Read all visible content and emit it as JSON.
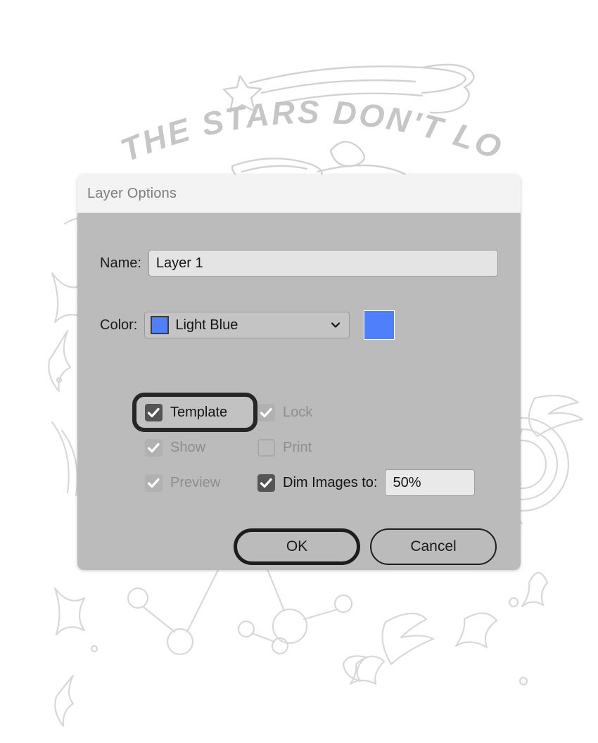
{
  "background": {
    "headline": "THE STARS DON'T LOOK",
    "description": "light-gray hand-drawn sketch of stars, sparkles, constellations and a comet",
    "ink_color": "#cfcfcf",
    "page_color": "#ffffff"
  },
  "dialog": {
    "title": "Layer Options",
    "titlebar_color": "#f3f3f3",
    "body_color": "#bbbbbb",
    "name": {
      "label": "Name:",
      "value": "Layer 1",
      "placeholder": "Layer name"
    },
    "color": {
      "label": "Color:",
      "selected": "Light Blue",
      "swatch_hex": "#4f7ffb",
      "preview_hex": "#4f7ffb",
      "chevron_icon": "chevron-down-icon",
      "options": [
        "Light Blue"
      ]
    },
    "options": {
      "template": {
        "label": "Template",
        "checked": true,
        "disabled": false,
        "focused": true
      },
      "lock": {
        "label": "Lock",
        "checked": true,
        "disabled": true,
        "focused": false
      },
      "show": {
        "label": "Show",
        "checked": true,
        "disabled": true,
        "focused": false
      },
      "print": {
        "label": "Print",
        "checked": false,
        "disabled": true,
        "focused": false
      },
      "preview": {
        "label": "Preview",
        "checked": true,
        "disabled": true,
        "focused": false
      },
      "dim_images": {
        "label": "Dim Images to:",
        "checked": true,
        "disabled": false,
        "value": "50%",
        "placeholder": "50%"
      }
    },
    "buttons": {
      "ok": "OK",
      "cancel": "Cancel"
    }
  }
}
